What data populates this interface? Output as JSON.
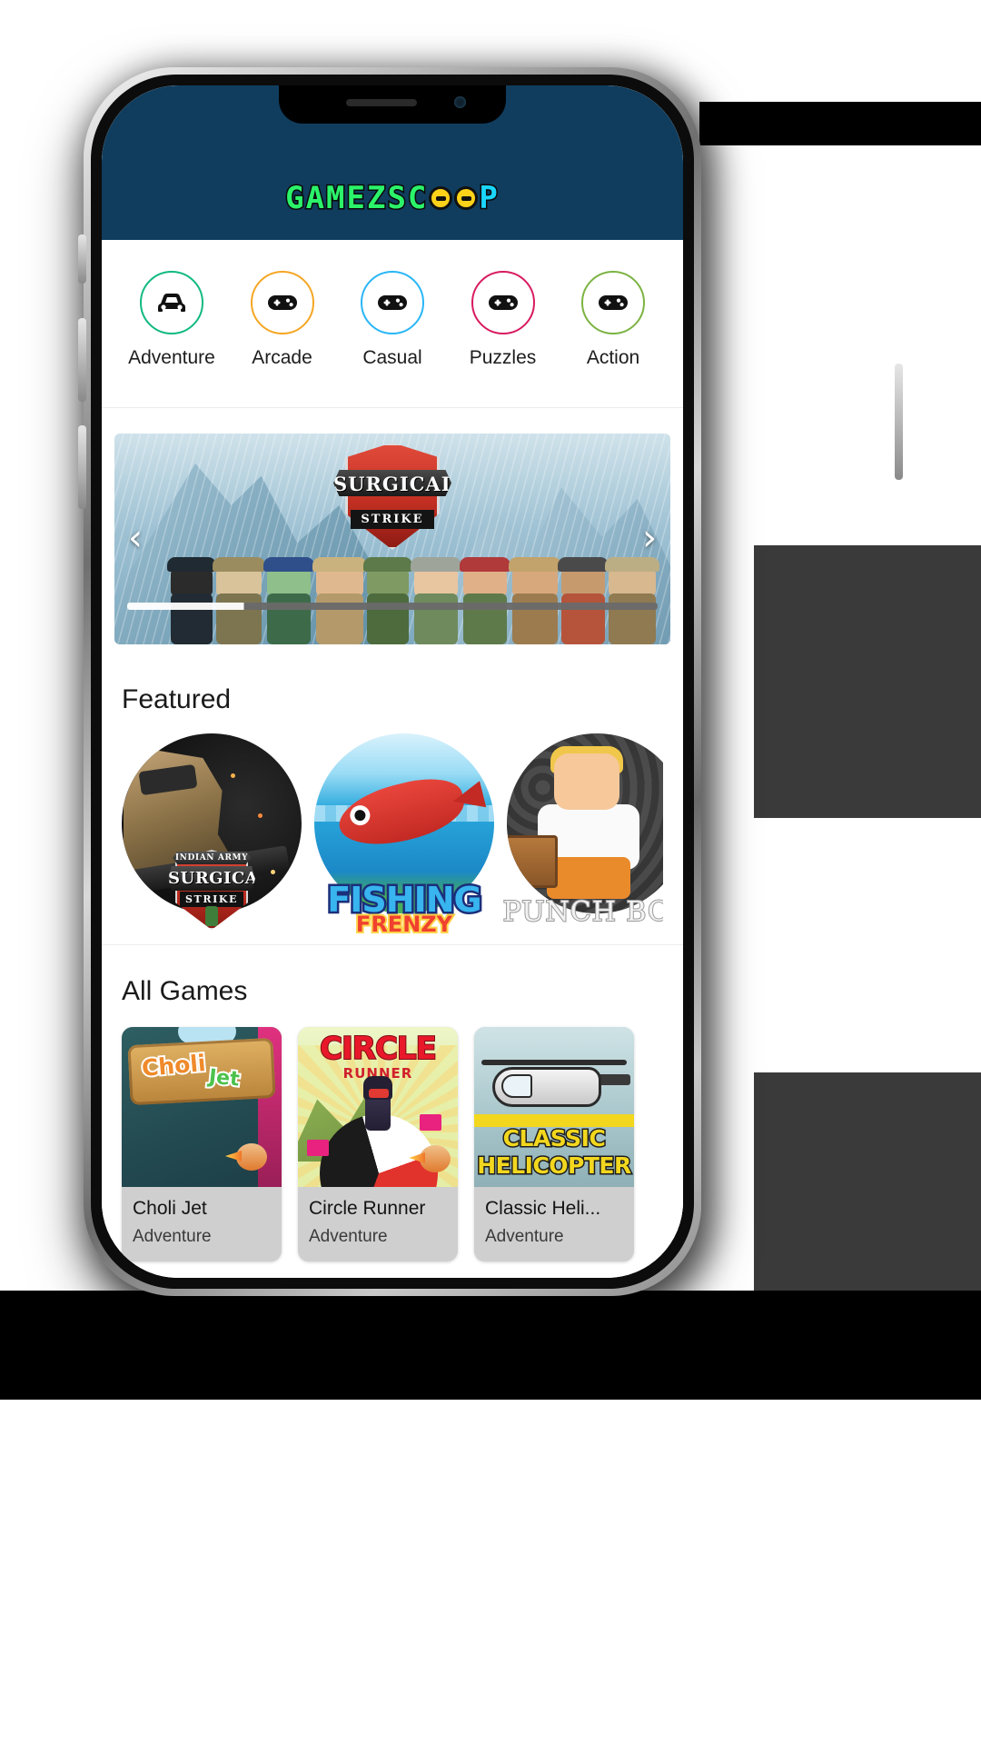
{
  "app": {
    "name": "GamezScoop",
    "logo": {
      "text_a": "GAMEZSC",
      "text_b": "P",
      "icon": "gamepad-dots"
    }
  },
  "categories": [
    {
      "label": "Adventure",
      "icon": "car-icon",
      "color": "#10b981"
    },
    {
      "label": "Arcade",
      "icon": "gamepad-icon",
      "color": "#f5a623"
    },
    {
      "label": "Casual",
      "icon": "gamepad-icon",
      "color": "#29b6f6"
    },
    {
      "label": "Puzzles",
      "icon": "gamepad-icon",
      "color": "#d81b60"
    },
    {
      "label": "Action",
      "icon": "gamepad-icon",
      "color": "#7cb342"
    }
  ],
  "banner": {
    "title_main": "SURGICAL",
    "title_sub": "STRIKE",
    "prev_icon": "chevron-left-icon",
    "prev_label": "‹",
    "next_icon": "chevron-right-icon",
    "next_label": "›"
  },
  "featured": {
    "title": "Featured",
    "items": [
      {
        "name": "Surgical Strike",
        "badge_top": "INDIAN ARMY",
        "badge_main": "SURGICAL",
        "badge_sub": "STRIKE"
      },
      {
        "name": "Fishing Frenzy",
        "title_line1": "FISHING",
        "title_line2": "FRENZY"
      },
      {
        "name": "Punch Box",
        "title_line1": "PUNCH BOX"
      }
    ]
  },
  "all_games": {
    "title": "All Games",
    "items": [
      {
        "name": "Choli Jet",
        "category": "Adventure",
        "art_line1": "Choli",
        "art_line2": "Jet"
      },
      {
        "name": "Circle Runner",
        "category": "Adventure",
        "art_line1": "CIRCLE",
        "art_line2": "RUNNER"
      },
      {
        "name": "Classic Heli...",
        "category": "Adventure",
        "art_line1": "CLASSIC",
        "art_line2": "HELICOPTER"
      }
    ]
  },
  "theme": {
    "header_bg": "#103d5e",
    "page_bg": "#ffffff",
    "card_bg": "#cfcfcf",
    "text_primary": "#141414"
  }
}
